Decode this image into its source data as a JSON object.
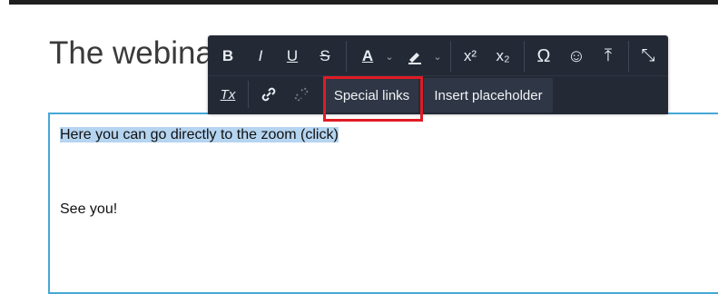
{
  "page": {
    "heading": "The webina",
    "content": {
      "line1": "Here you can go directly to the zoom (click)",
      "line2": "See you!"
    }
  },
  "toolbar": {
    "bold": "B",
    "italic": "I",
    "underline": "U",
    "strike": "S",
    "font_color": "A",
    "superscript": "x²",
    "subscript": "x₂",
    "omega": "Ω",
    "emoji": "☺",
    "upload": "⤒",
    "collapse": "⤡",
    "clear_format": "Tx",
    "link": "🔗",
    "unlink": "⛓",
    "special_links": "Special links",
    "insert_placeholder": "Insert placeholder"
  },
  "colors": {
    "toolbar_bg": "#232a36",
    "highlight": "#b5d4f0",
    "editor_border": "#46a8d6",
    "callout": "#e01b24"
  }
}
